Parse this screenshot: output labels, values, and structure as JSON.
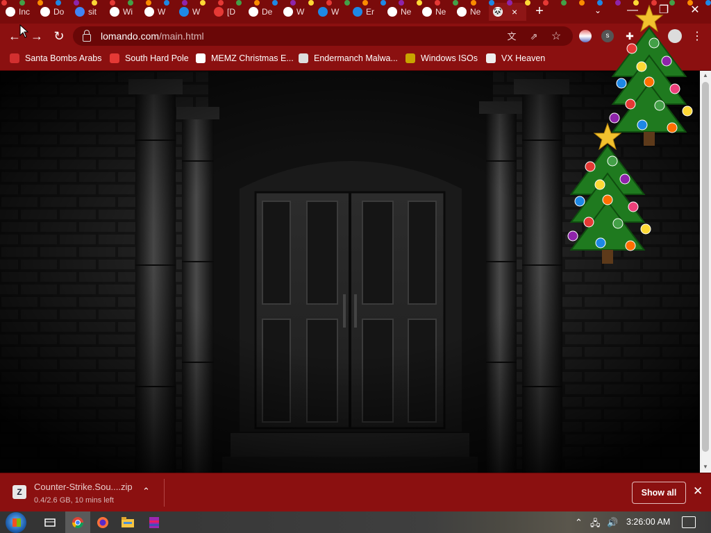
{
  "browser": {
    "tabs": [
      {
        "label": "Inc",
        "favicon": "chrome-icon",
        "color": "#ffffff"
      },
      {
        "label": "Do",
        "favicon": "download-icon",
        "color": "#ffffff"
      },
      {
        "label": "sit",
        "favicon": "google-icon",
        "color": "#4285f4"
      },
      {
        "label": "Wi",
        "favicon": "wikipedia-icon",
        "color": "#ffffff"
      },
      {
        "label": "W",
        "favicon": "wikipedia-icon",
        "color": "#ffffff"
      },
      {
        "label": "W",
        "favicon": "onedrive-icon",
        "color": "#1e88e5"
      },
      {
        "label": "[D",
        "favicon": "doc-icon",
        "color": "#e53935"
      },
      {
        "label": "De",
        "favicon": "wikipedia-icon",
        "color": "#ffffff"
      },
      {
        "label": "W",
        "favicon": "wikipedia-icon",
        "color": "#ffffff"
      },
      {
        "label": "W",
        "favicon": "onedrive-icon",
        "color": "#1e88e5"
      },
      {
        "label": "Er",
        "favicon": "onedrive-icon",
        "color": "#1e88e5"
      },
      {
        "label": "Ne",
        "favicon": "chrome-icon",
        "color": "#ffffff"
      },
      {
        "label": "Ne",
        "favicon": "chrome-icon",
        "color": "#ffffff"
      },
      {
        "label": "Ne",
        "favicon": "chrome-icon",
        "color": "#ffffff"
      }
    ],
    "active_tab": {
      "favicon": "panda-icon",
      "close": "×"
    },
    "new_tab": "+",
    "tab_search": "⌄",
    "window_controls": {
      "minimize": "—",
      "maximize": "❐",
      "close": "✕"
    },
    "url": {
      "host": "lomando.com",
      "path": "/main.html"
    },
    "nav": {
      "back": "←",
      "forward": "→",
      "reload": "↻"
    },
    "toolbar_icons": {
      "translate": "文",
      "share": "⇗",
      "bookmark": "☆",
      "extensions": "✚",
      "menu": "⋮"
    }
  },
  "bookmarks": [
    {
      "label": "Santa Bombs Arabs",
      "icon": "santa-icon",
      "color": "#d32f2f"
    },
    {
      "label": "South Hard Pole",
      "icon": "snowflake-icon",
      "color": "#e53935"
    },
    {
      "label": "MEMZ Christmas E...",
      "icon": "memz-icon",
      "color": "#ffffff"
    },
    {
      "label": "Endermanch Malwa...",
      "icon": "panda-icon",
      "color": "#dddddd"
    },
    {
      "label": "Windows ISOs",
      "icon": "windows-icon",
      "color": "#c8a400"
    },
    {
      "label": "VX Heaven",
      "icon": "vx-icon",
      "color": "#eeeeee"
    }
  ],
  "download": {
    "filename": "Counter-Strike.Sou....zip",
    "status": "0.4/2.6 GB, 10 mins left",
    "expand": "⌃",
    "show_all": "Show all",
    "close": "✕"
  },
  "taskbar": {
    "items": [
      "task-view",
      "chrome",
      "firefox",
      "file-explorer",
      "winrar"
    ],
    "tray": {
      "chevron": "⌃",
      "network": "🖧",
      "volume": "🔊"
    },
    "clock": "3:26:00 AM"
  },
  "colors": {
    "theme_dark": "#7a0b0b",
    "theme": "#8b1010",
    "accent_text": "#e4bdbd"
  }
}
